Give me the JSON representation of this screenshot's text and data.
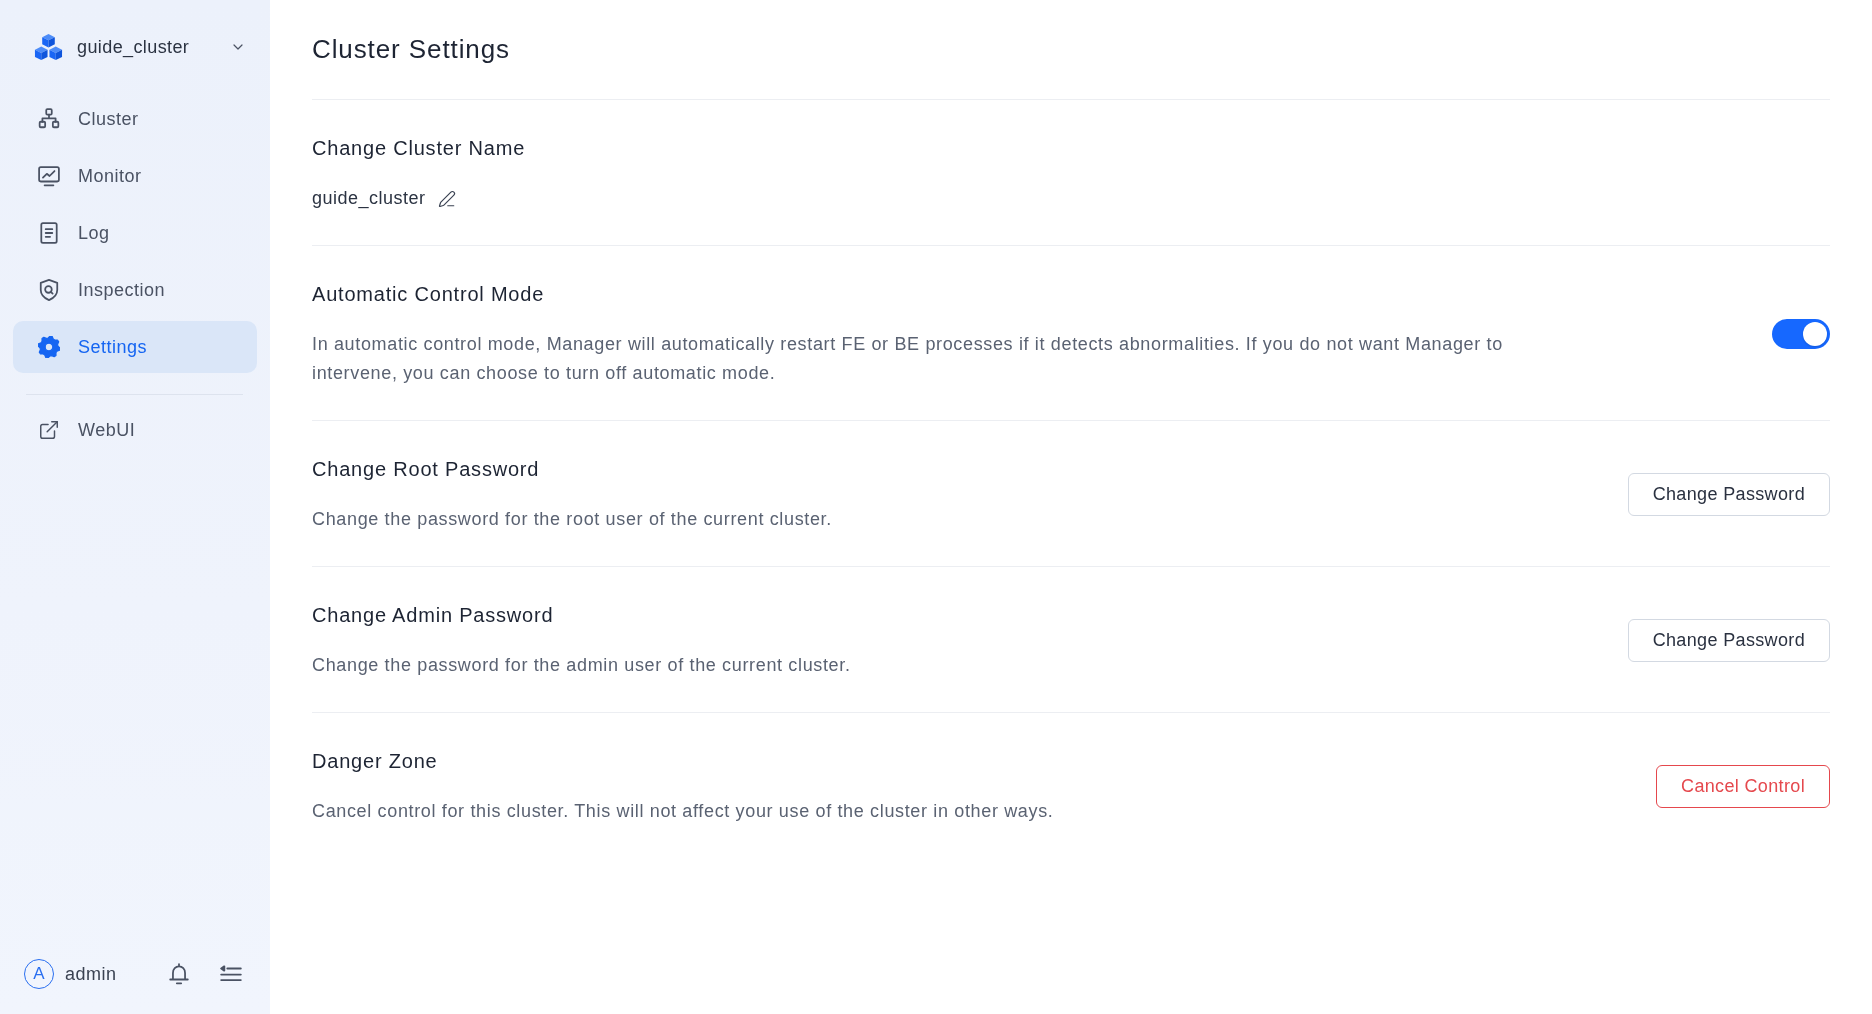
{
  "sidebar": {
    "cluster_switcher": {
      "name": "guide_cluster"
    },
    "nav_items": [
      {
        "label": "Cluster",
        "selected": false
      },
      {
        "label": "Monitor",
        "selected": false
      },
      {
        "label": "Log",
        "selected": false
      },
      {
        "label": "Inspection",
        "selected": false
      },
      {
        "label": "Settings",
        "selected": true
      }
    ],
    "links": [
      {
        "label": "WebUI"
      }
    ],
    "user": {
      "avatar_initial": "A",
      "name": "admin"
    }
  },
  "page": {
    "title": "Cluster Settings",
    "sections": [
      {
        "kind": "editable_name",
        "title": "Change Cluster Name",
        "value": "guide_cluster"
      },
      {
        "kind": "toggle",
        "title": "Automatic Control Mode",
        "description": "In automatic control mode, Manager will automatically restart FE or BE processes if it detects abnormalities. If you do not want Manager to intervene, you can choose to turn off automatic mode.",
        "on": true
      },
      {
        "kind": "button",
        "title": "Change Root Password",
        "description": "Change the password for the root user of the current cluster.",
        "button": {
          "label": "Change Password",
          "danger": false
        }
      },
      {
        "kind": "button",
        "title": "Change Admin Password",
        "description": "Change the password for the admin user of the current cluster.",
        "button": {
          "label": "Change Password",
          "danger": false
        }
      },
      {
        "kind": "button",
        "title": "Danger Zone",
        "description": "Cancel control for this cluster. This will not affect your use of the cluster in other ways.",
        "button": {
          "label": "Cancel Control",
          "danger": true
        }
      }
    ]
  }
}
